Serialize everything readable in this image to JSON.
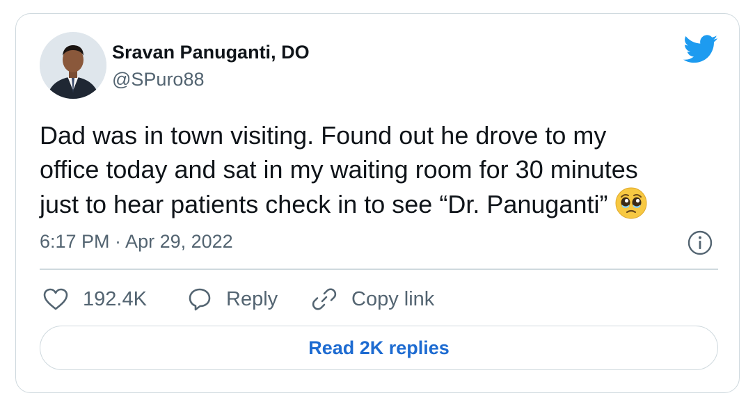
{
  "author": {
    "name": "Sravan Panuganti, DO",
    "handle": "@SPuro88"
  },
  "tweet": {
    "lines": [
      "Dad was in town visiting. Found out he drove to my",
      "office today and sat in my waiting room for 30 minutes",
      "just to hear patients check in to see “Dr. Panuganti”"
    ],
    "emoji": "pleading-face-emoji",
    "timestamp": "6:17 PM · Apr 29, 2022"
  },
  "actions": {
    "like_count": "192.4K",
    "reply_label": "Reply",
    "copy_link_label": "Copy link"
  },
  "read_replies_label": "Read 2K replies",
  "icons": {
    "brand": "twitter-bird-icon",
    "info": "info-icon",
    "like": "heart-icon",
    "reply": "reply-bubble-icon",
    "copy": "link-icon"
  },
  "colors": {
    "twitter_blue": "#1d9bf0",
    "link_blue": "#1d6bd1",
    "secondary_text": "#536471",
    "border": "#cfd9de"
  }
}
